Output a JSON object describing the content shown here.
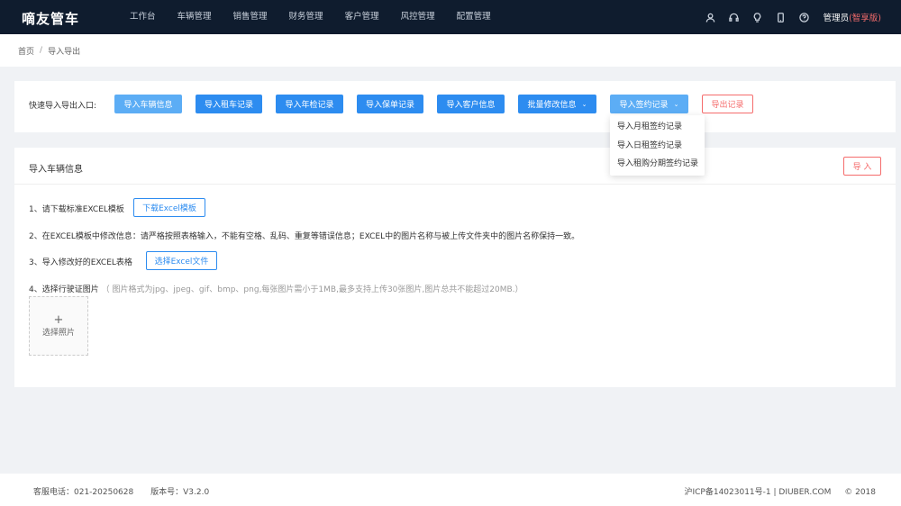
{
  "app": {
    "logo": "嘀友管车"
  },
  "nav": [
    "工作台",
    "车辆管理",
    "销售管理",
    "财务管理",
    "客户管理",
    "风控管理",
    "配置管理"
  ],
  "user": {
    "name": "管理员",
    "edition": "(智享版)"
  },
  "breadcrumb": {
    "home": "首页",
    "sep": "/",
    "current": "导入导出"
  },
  "quick": {
    "label": "快速导入导出入口:",
    "buttons": [
      "导入车辆信息",
      "导入租车记录",
      "导入年检记录",
      "导入保单记录",
      "导入客户信息",
      "批量修改信息",
      "导入签约记录"
    ],
    "export": "导出记录",
    "dropdown": [
      "导入月租签约记录",
      "导入日租签约记录",
      "导入租购分期签约记录"
    ]
  },
  "section": {
    "title": "导入车辆信息",
    "import_btn": "导 入",
    "step1": "1、请下载标准EXCEL模板",
    "download_btn": "下载Excel模板",
    "step2": "2、在EXCEL模板中修改信息：请严格按照表格输入，不能有空格、乱码、重复等错误信息；EXCEL中的图片名称与被上传文件夹中的图片名称保持一致。",
    "step3": "3、导入修改好的EXCEL表格",
    "choose_btn": "选择Excel文件",
    "step4": "4、选择行驶证图片",
    "step4_hint": "（ 图片格式为jpg、jpeg、gif、bmp、png,每张图片需小于1MB,最多支持上传30张图片,图片总共不能超过20MB.）",
    "upload_plus": "+",
    "upload_label": "选择照片"
  },
  "footer": {
    "phone": "客服电话：021-20250628",
    "version": "版本号：V3.2.0",
    "icp": "沪ICP备14023011号-1 | DIUBER.COM",
    "copyright": "© 2018"
  },
  "colors": {
    "topbar": "#0f1c2e",
    "primary": "#2d8cf0",
    "danger": "#f56c6c"
  }
}
